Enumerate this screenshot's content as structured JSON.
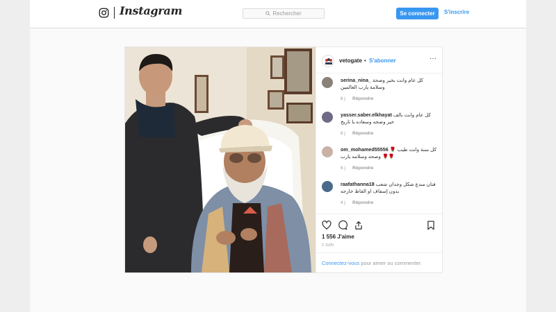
{
  "header": {
    "wordmark": "Instagram",
    "search_placeholder": "Rechercher",
    "login_label": "Se connecter",
    "signup_label": "S'inscrire"
  },
  "post": {
    "username": "vetogate",
    "separator": "•",
    "follow_label": "S'abonner",
    "more_label": "···",
    "comments": [
      {
        "user": "serina_nina_",
        "text": "كل عام وانت بخير وصحة وسلامة يارب العالمين",
        "age": "6 j",
        "reply": "Répondre",
        "avatar_color": "#8a8178"
      },
      {
        "user": "yasser.saber.elkhayat",
        "text": "كل عام وانت بالف خير وصحه وسعاده يا تاريخ",
        "age": "6 j",
        "reply": "Répondre",
        "avatar_color": "#6f6a86"
      },
      {
        "user": "om_mohamed55556",
        "text": "كل سنة وانت طيب 🌹🌹🌹 وصحه وسلامه يارب",
        "age": "6 j",
        "reply": "Répondre",
        "avatar_color": "#c9b1a6"
      },
      {
        "user": "raafathanna18",
        "text": "فنان مبدع شكل وجدان شعب بدون إسفاف او الفاظ خارجه",
        "age": "4 j",
        "reply": "Répondre",
        "avatar_color": "#4a6a8a"
      }
    ],
    "likes": "1 556 J'aime",
    "date": "2 juin",
    "login_link": "Connectez-vous",
    "login_suffix": " pour aimer ou commenter."
  },
  "colors": {
    "accent": "#3897f0",
    "muted": "#999999",
    "border": "#dbdbdb",
    "text": "#262626"
  }
}
